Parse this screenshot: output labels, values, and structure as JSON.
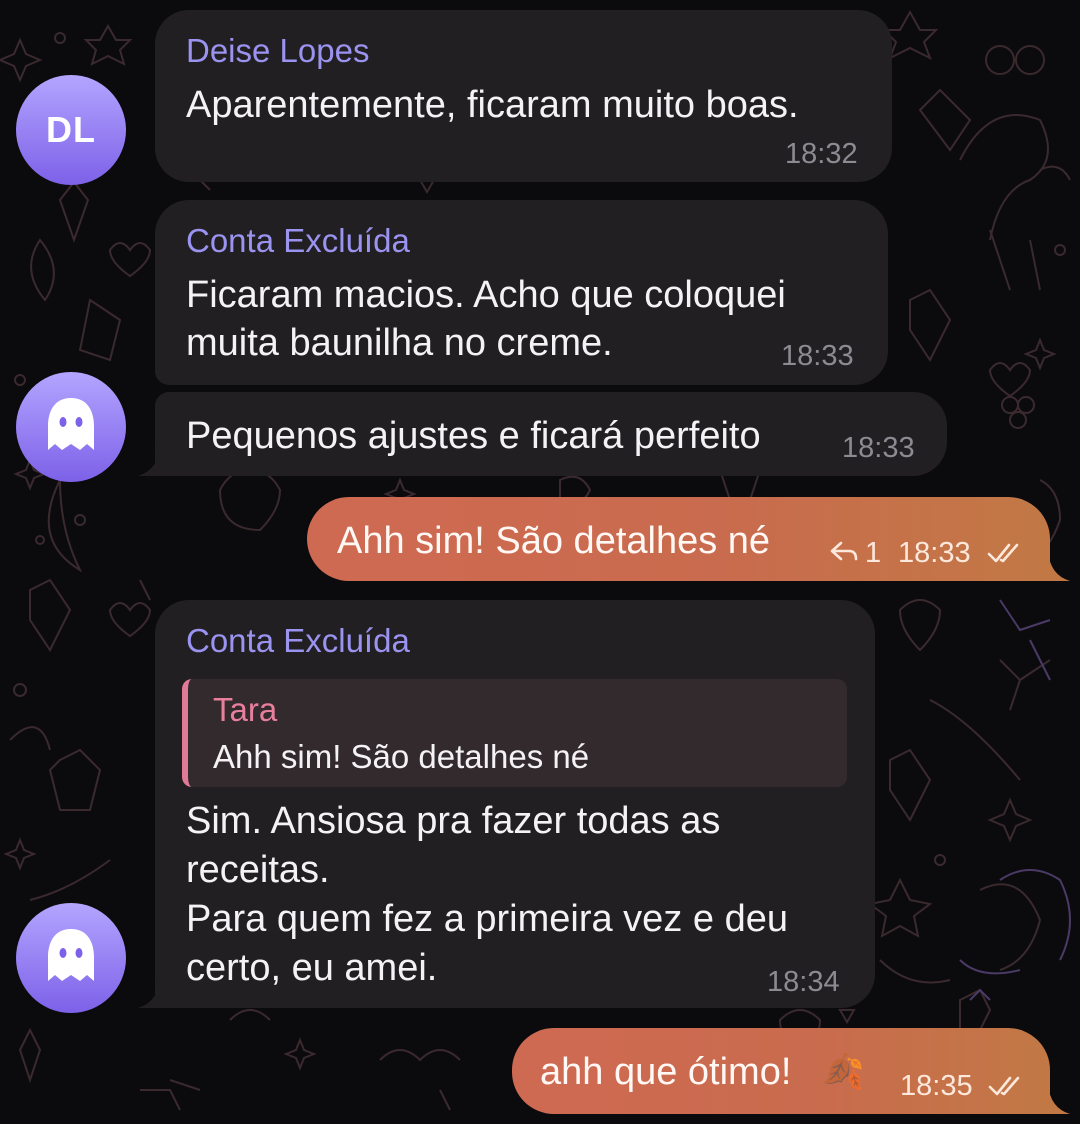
{
  "chat": {
    "messages": [
      {
        "sender": "Deise Lopes",
        "text": "Aparentemente, ficaram muito boas.",
        "time": "18:32"
      },
      {
        "sender": "Conta Excluída",
        "lines": [
          "Ficaram macios. Acho que coloquei",
          "muita baunilha no creme."
        ],
        "time": "18:33"
      },
      {
        "text": "Pequenos ajustes e ficará perfeito",
        "time": "18:33"
      },
      {
        "text": "Ahh sim! São detalhes né",
        "reply_count": "1",
        "time": "18:33",
        "status": "read"
      },
      {
        "sender": "Conta Excluída",
        "reply": {
          "name": "Tara",
          "text": "Ahh sim! São detalhes né"
        },
        "lines": [
          "Sim. Ansiosa pra fazer todas as",
          "receitas.",
          "Para quem fez a primeira vez e deu",
          "certo, eu amei."
        ],
        "time": "18:34"
      },
      {
        "text": "ahh que ótimo!",
        "emoji": "🍂",
        "time": "18:35",
        "status": "read"
      }
    ],
    "avatars": [
      {
        "initials": "DL"
      },
      {
        "icon": "ghost-icon"
      },
      {
        "icon": "ghost-icon"
      }
    ],
    "colors": {
      "incoming_bubble": "#211f22",
      "outgoing_gradient": [
        "#cf6a52",
        "#c27845"
      ],
      "sender_name": "#9b93f0",
      "reply_name": "#e87f9c",
      "avatar_gradient": [
        "#b3a5ff",
        "#7d61e8"
      ]
    }
  }
}
